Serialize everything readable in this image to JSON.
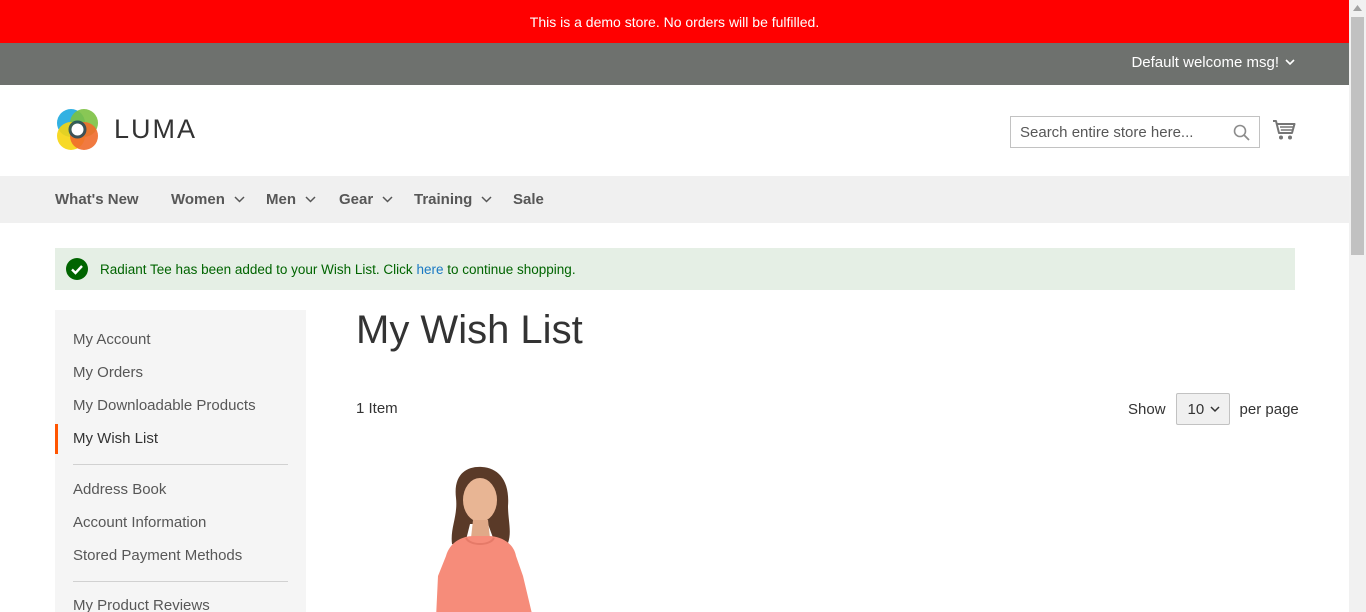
{
  "demo_notice": "This is a demo store. No orders will be fulfilled.",
  "panel": {
    "welcome": "Default welcome msg!"
  },
  "header": {
    "logo_text": "LUMA",
    "search_placeholder": "Search entire store here..."
  },
  "nav": {
    "items": [
      {
        "label": "What's New",
        "has_dropdown": false
      },
      {
        "label": "Women",
        "has_dropdown": true
      },
      {
        "label": "Men",
        "has_dropdown": true
      },
      {
        "label": "Gear",
        "has_dropdown": true
      },
      {
        "label": "Training",
        "has_dropdown": true
      },
      {
        "label": "Sale",
        "has_dropdown": false
      }
    ]
  },
  "message": {
    "prefix": "Radiant Tee has been added to your Wish List. Click ",
    "link": "here",
    "suffix": " to continue shopping."
  },
  "sidebar": {
    "items": [
      {
        "label": "My Account"
      },
      {
        "label": "My Orders"
      },
      {
        "label": "My Downloadable Products"
      },
      {
        "label": "My Wish List",
        "active": true
      },
      {
        "label": "Address Book"
      },
      {
        "label": "Account Information"
      },
      {
        "label": "Stored Payment Methods"
      },
      {
        "label": "My Product Reviews"
      }
    ]
  },
  "main": {
    "title": "My Wish List",
    "item_count": "1 Item",
    "limiter": {
      "show_label": "Show",
      "value": "10",
      "per_page_label": "per page"
    }
  },
  "colors": {
    "demo_bar": "#ff0000",
    "panel": "#6e716e",
    "nav_bg": "#f0f0f0",
    "message_bg": "#e5efe5",
    "message_text": "#006400",
    "link": "#1979c3",
    "active_marker": "#ff5501"
  }
}
